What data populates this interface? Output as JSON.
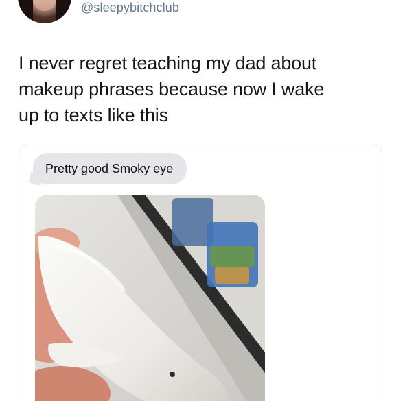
{
  "tweet": {
    "handle": "@sleepybitchclub",
    "text": "I never regret teaching my dad about\nmakeup phrases because now I wake\nup to texts like this"
  },
  "message": {
    "bubble_text": "Pretty good Smoky eye"
  },
  "colors": {
    "handle": "#657786",
    "text": "#14171a",
    "bubble_bg": "#e5e5ea",
    "card_border": "#e6ecf0"
  },
  "icons": {
    "avatar": "profile-photo",
    "photo": "white-beluga-whale-figurine-held-in-hand"
  }
}
